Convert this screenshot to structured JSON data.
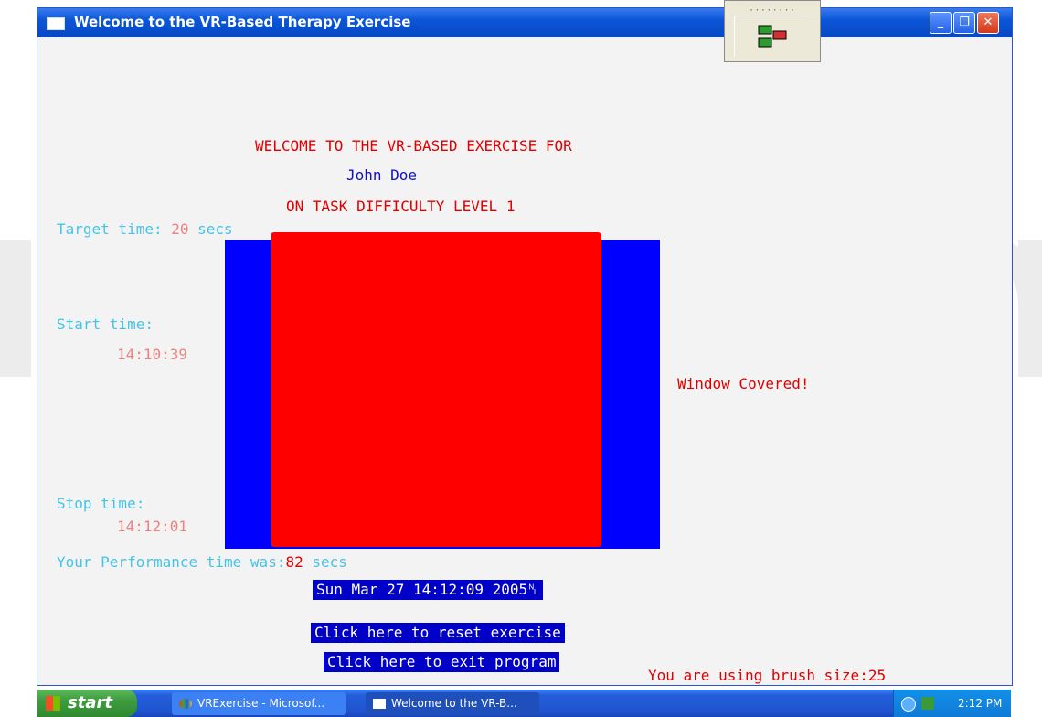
{
  "window": {
    "title": "Welcome to the VR-Based Therapy Exercise",
    "minimize_glyph": "_",
    "maximize_glyph": "❐",
    "close_glyph": "✕"
  },
  "widget": {
    "dots": "········"
  },
  "header": {
    "line1": "WELCOME TO THE VR-BASED EXERCISE FOR",
    "user_name": "John Doe",
    "line3": "ON TASK DIFFICULTY LEVEL 1"
  },
  "target": {
    "label": "Target time: ",
    "value": "20",
    "unit": " secs"
  },
  "start": {
    "label": "Start time:",
    "value": "14:10:39"
  },
  "stop": {
    "label": "Stop time:",
    "value": "14:12:01"
  },
  "status": {
    "message": "Window Covered!"
  },
  "performance": {
    "label": "Your Performance time was:",
    "value": "82",
    "unit": " secs"
  },
  "timestamp": "Sun Mar 27 14:12:09 2005␤",
  "buttons": {
    "reset": "Click here to reset exercise",
    "exit": "Click here to exit program"
  },
  "brush": {
    "label": "You are using brush size:",
    "value": "25"
  },
  "taskbar": {
    "start_label": "start",
    "tasks": [
      "VRExercise - Microsof...",
      "Welcome to the VR-B..."
    ],
    "clock": "2:12 PM"
  },
  "colors": {
    "canvas_blue": "#0000ff",
    "cover_red": "#ff0000",
    "title_blue": "#0a56d8",
    "label_cyan": "#44c4e8",
    "value_pink": "#f08080"
  }
}
